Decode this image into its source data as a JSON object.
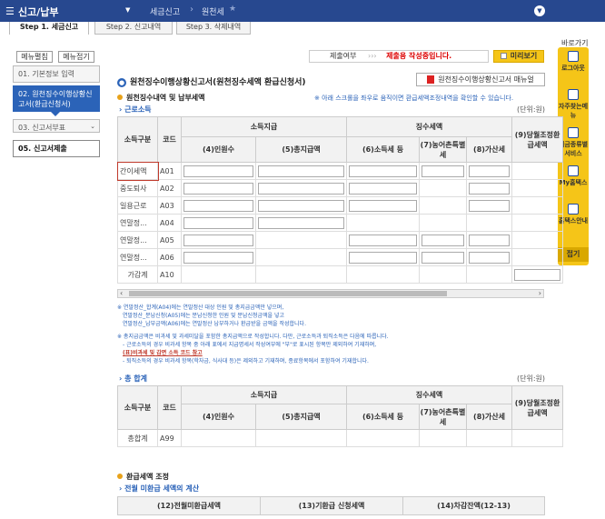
{
  "topbar": {
    "title": "신고/납부",
    "breadcrumb1": "세금신고",
    "breadcrumb2": "원천세"
  },
  "steps": [
    "Step 1. 세금신고",
    "Step 2. 신고내역",
    "Step 3. 삭제내역"
  ],
  "leftnav": {
    "open_btn": "메뉴펼침",
    "close_btn": "메뉴접기",
    "items": [
      "01. 기본정보 입력",
      "02. 원천징수이행상황신고서(환급신청서)",
      "03. 신고서부표",
      "05. 신고서제출"
    ]
  },
  "rightpanel": {
    "title": "바로가기",
    "items": [
      "로그아웃",
      "자주찾는메뉴",
      "세금종류별서비스",
      "My홈택스",
      "홈택스안내"
    ],
    "close": "접기"
  },
  "header": {
    "filing_label": "제출여부",
    "filing_arrows": "›››",
    "filing_status": "제출용 작성중입니다.",
    "preview": "미리보기"
  },
  "section": {
    "title": "원천징수이행상황신고서(원천징수세액 환급신청서)",
    "manual": "원천징수이행상황신고서 매뉴얼",
    "sub1": "원천징수내역 및 납부세액",
    "note_right": "※ 아래 스크롤을 좌우로 움직이면 환급세액조정내역을 확인할 수 있습니다.",
    "link1": "근로소득",
    "unit": "(단위:원)",
    "link2": "총 합계",
    "sub2": "환급세액 조정",
    "link3": "전월 미환급 세액의 계산"
  },
  "table1": {
    "h_income": "소득구분",
    "h_code": "코드",
    "h_pay": "소득지급",
    "h_tax": "징수세액",
    "h_people": "(4)인원수",
    "h_total": "(5)총지급액",
    "h_incometax": "(6)소득세 등",
    "h_rural": "(7)농어촌특별세",
    "h_addtax": "(8)가산세",
    "h_adjust": "(9)당월조정환급세액",
    "rows": [
      {
        "name": "간이세액",
        "code": "A01"
      },
      {
        "name": "중도퇴사",
        "code": "A02"
      },
      {
        "name": "일용근로",
        "code": "A03"
      },
      {
        "name": "연말정...",
        "code": "A04"
      },
      {
        "name": "연말정...",
        "code": "A05"
      },
      {
        "name": "연말정...",
        "code": "A06"
      },
      {
        "name": "가감계",
        "code": "A10"
      }
    ]
  },
  "notes": {
    "n1": "※ 연말정산_합계(A04)에는 연말정산 대상 인원 및 총지급금액만 넣으며,",
    "n2": "연말정산_분납신청(A05)에는 분납신청한 인원 및 분납신청금액을 넣고",
    "n3": "연말정산_납부금액(A06)에는 연말정산 납부하거나 환급받을 금액을 작성합니다.",
    "n4": "※ 총지급금액은 비과세 및 과세미달을 포함한 총지급액으로 작성합니다. 다만, 근로소득과 퇴직소득은 다음에 따릅니다.",
    "n5": "- 근로소득의 경우 비과세 항목 중 아래 표에서 지급명세서 작성여부에 \"부\"로 표시된 항목만 제외하여 기재하며,",
    "n6": "(표)비과세 및 감면 소득 코드 참고",
    "n7": "- 퇴직소득의 경우 비과세 항목(학자금, 식사대 등)은 제외하고 기재하며, 종료항목에서 포함하여 기재합니다."
  },
  "table2": {
    "rows": [
      {
        "name": "총합계",
        "code": "A99"
      }
    ]
  },
  "table3": {
    "h12": "(12)전월미환급세액",
    "h13": "(13)기환급 신청세액",
    "h14": "(14)차감잔액(12-13)"
  }
}
